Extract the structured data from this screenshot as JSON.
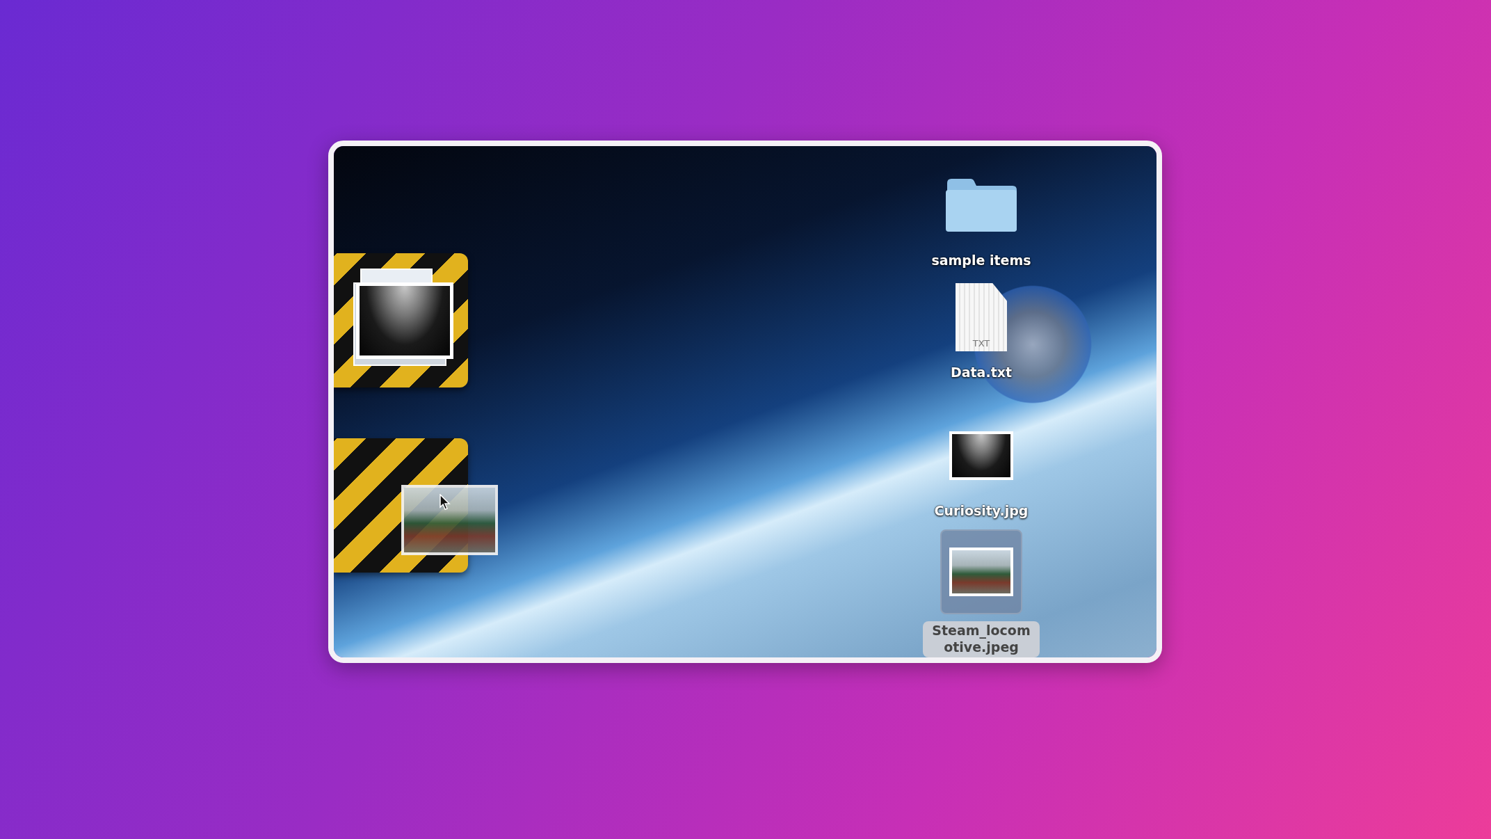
{
  "desktop": {
    "drop_zones": [
      {
        "kind": "stack"
      },
      {
        "kind": "dragging"
      }
    ],
    "icons": [
      {
        "kind": "folder",
        "label": "sample items",
        "selected": false
      },
      {
        "kind": "document",
        "badge": "TXT",
        "label": "Data.txt",
        "selected": false
      },
      {
        "kind": "image",
        "label": "Curiosity.jpg",
        "selected": false
      },
      {
        "kind": "photo",
        "label": "Steam_locomotive.jpeg",
        "selected": true
      }
    ]
  }
}
